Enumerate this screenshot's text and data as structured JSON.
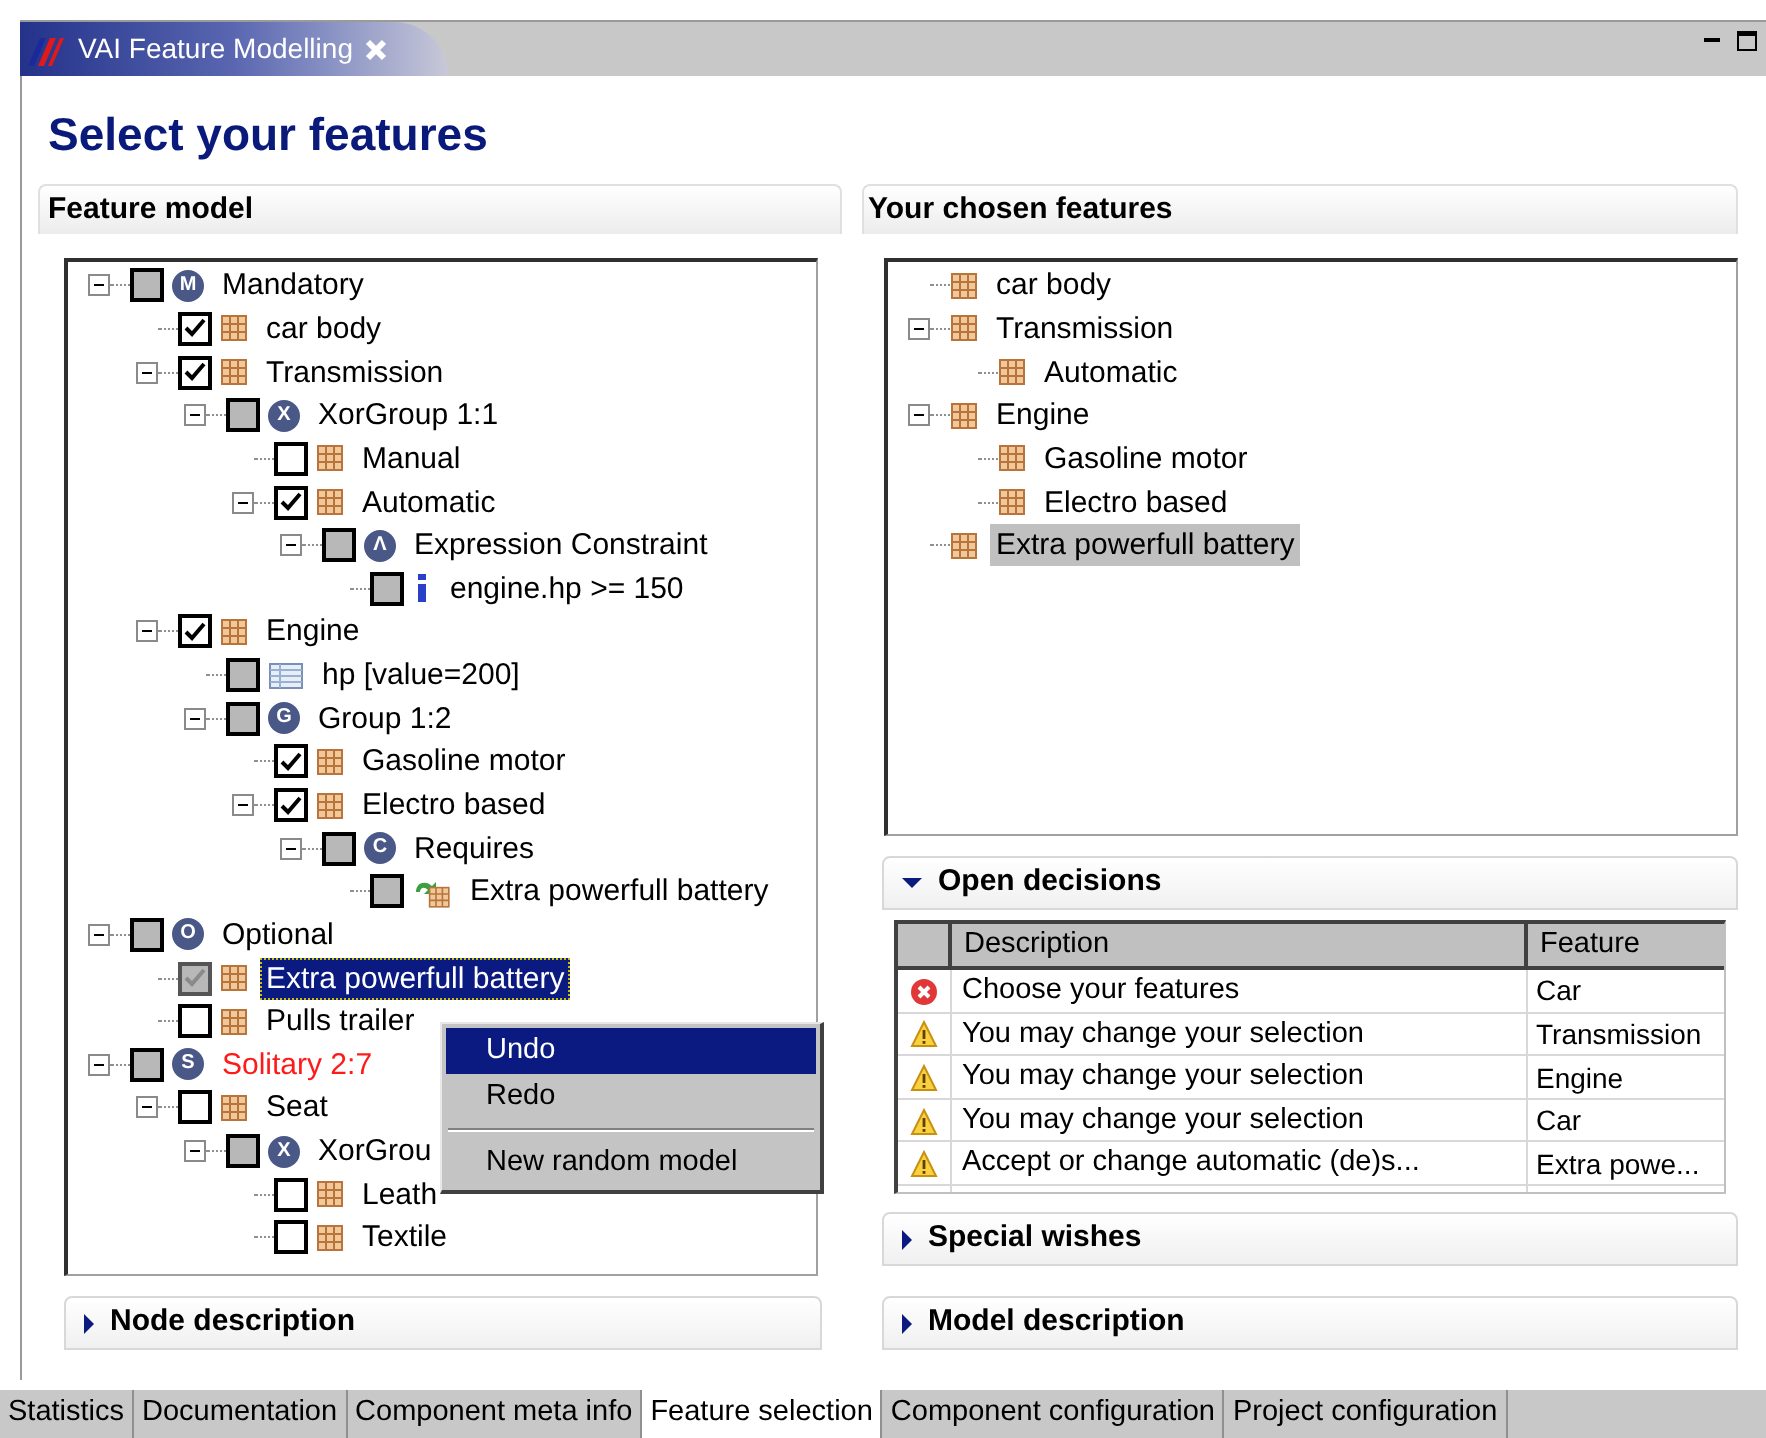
{
  "editor_tab": {
    "title": "VAI Feature Modelling"
  },
  "page_title": "Select your features",
  "feature_model": {
    "title": "Feature model",
    "tree": [
      {
        "label": "Mandatory",
        "kind": "group",
        "badge": "M",
        "checked": false,
        "disabled": true,
        "selected": false,
        "expanded": true,
        "children": [
          {
            "label": "car body",
            "kind": "feature",
            "checked": true,
            "disabled": false,
            "selected": false
          },
          {
            "label": "Transmission",
            "kind": "feature",
            "checked": true,
            "disabled": false,
            "selected": false,
            "expanded": true,
            "children": [
              {
                "label": "XorGroup 1:1",
                "kind": "group",
                "badge": "X",
                "checked": false,
                "disabled": true,
                "selected": false,
                "expanded": true,
                "children": [
                  {
                    "label": "Manual",
                    "kind": "feature",
                    "checked": false,
                    "disabled": false,
                    "selected": false
                  },
                  {
                    "label": "Automatic",
                    "kind": "feature",
                    "checked": true,
                    "disabled": false,
                    "selected": false,
                    "expanded": true,
                    "children": [
                      {
                        "label": "Expression Constraint",
                        "kind": "group",
                        "badge": "Λ",
                        "checked": false,
                        "disabled": true,
                        "selected": false,
                        "expanded": true,
                        "children": [
                          {
                            "label": "engine.hp >= 150",
                            "kind": "expression",
                            "checked": false,
                            "disabled": true,
                            "selected": false
                          }
                        ]
                      }
                    ]
                  }
                ]
              }
            ]
          },
          {
            "label": "Engine",
            "kind": "feature",
            "checked": true,
            "disabled": false,
            "selected": false,
            "expanded": true,
            "children": [
              {
                "label": "hp [value=200]",
                "kind": "attribute",
                "checked": false,
                "disabled": true,
                "selected": false
              },
              {
                "label": "Group 1:2",
                "kind": "group",
                "badge": "G",
                "checked": false,
                "disabled": true,
                "selected": false,
                "expanded": true,
                "children": [
                  {
                    "label": "Gasoline motor",
                    "kind": "feature",
                    "checked": true,
                    "disabled": false,
                    "selected": false
                  },
                  {
                    "label": "Electro based",
                    "kind": "feature",
                    "checked": true,
                    "disabled": false,
                    "selected": false,
                    "expanded": true,
                    "children": [
                      {
                        "label": "Requires",
                        "kind": "group",
                        "badge": "C",
                        "checked": false,
                        "disabled": true,
                        "selected": false,
                        "expanded": true,
                        "children": [
                          {
                            "label": "Extra powerfull battery",
                            "kind": "reference",
                            "checked": false,
                            "disabled": true,
                            "selected": false
                          }
                        ]
                      }
                    ]
                  }
                ]
              }
            ]
          }
        ]
      },
      {
        "label": "Optional",
        "kind": "group",
        "badge": "O",
        "checked": false,
        "disabled": true,
        "selected": false,
        "expanded": true,
        "children": [
          {
            "label": "Extra powerfull battery",
            "kind": "feature",
            "checked": true,
            "disabled": true,
            "selected": true
          },
          {
            "label": "Pulls trailer",
            "kind": "feature",
            "checked": false,
            "disabled": false,
            "selected": false
          }
        ]
      },
      {
        "label": "Solitary 2:7",
        "kind": "group",
        "badge": "S",
        "error": true,
        "checked": false,
        "disabled": true,
        "selected": false,
        "expanded": true,
        "children": [
          {
            "label": "Seat",
            "kind": "feature",
            "checked": false,
            "disabled": false,
            "selected": false,
            "expanded": true,
            "children": [
              {
                "label": "XorGrou",
                "kind": "group",
                "badge": "X",
                "checked": false,
                "disabled": true,
                "selected": false,
                "expanded": true,
                "children": [
                  {
                    "label": "Leath",
                    "kind": "feature",
                    "checked": false,
                    "disabled": false,
                    "selected": false
                  },
                  {
                    "label": "Textile",
                    "kind": "feature",
                    "checked": false,
                    "disabled": false,
                    "selected": false
                  }
                ]
              }
            ]
          }
        ]
      }
    ]
  },
  "node_description": {
    "title": "Node description",
    "expanded": false
  },
  "chosen_features": {
    "title": "Your chosen features",
    "tree": [
      {
        "label": "car body",
        "kind": "feature",
        "selected": false
      },
      {
        "label": "Transmission",
        "kind": "feature",
        "selected": false,
        "expanded": true,
        "children": [
          {
            "label": "Automatic",
            "kind": "feature",
            "selected": false
          }
        ]
      },
      {
        "label": "Engine",
        "kind": "feature",
        "selected": false,
        "expanded": true,
        "children": [
          {
            "label": "Gasoline motor",
            "kind": "feature",
            "selected": false
          },
          {
            "label": "Electro based",
            "kind": "feature",
            "selected": false
          }
        ]
      },
      {
        "label": "Extra powerfull battery",
        "kind": "feature",
        "selected": true
      }
    ]
  },
  "open_decisions": {
    "title": "Open decisions",
    "expanded": true,
    "columns": [
      "Description",
      "Feature"
    ],
    "rows": [
      {
        "kind": "error",
        "description": "Choose your features",
        "feature": "Car"
      },
      {
        "kind": "warning",
        "description": "You may change your selection",
        "feature": "Transmission"
      },
      {
        "kind": "warning",
        "description": "You may change your selection",
        "feature": "Engine"
      },
      {
        "kind": "warning",
        "description": "You may change your selection",
        "feature": "Car"
      },
      {
        "kind": "warning",
        "description": "Accept or change automatic (de)s...",
        "feature": "Extra powe..."
      }
    ]
  },
  "special_wishes": {
    "title": "Special wishes",
    "expanded": false
  },
  "model_description": {
    "title": "Model description",
    "expanded": false
  },
  "context_menu": {
    "items": [
      {
        "kind": "command",
        "label": "Undo",
        "selected": true
      },
      {
        "kind": "command",
        "label": "Redo",
        "selected": false
      },
      {
        "kind": "separator"
      },
      {
        "kind": "command",
        "label": "New random model",
        "selected": false
      }
    ]
  },
  "bottom_tabs": [
    {
      "label": "Statistics",
      "selected": false
    },
    {
      "label": "Documentation",
      "selected": false
    },
    {
      "label": "Component meta info",
      "selected": false
    },
    {
      "label": "Feature selection",
      "selected": true
    },
    {
      "label": "Component configuration",
      "selected": false
    },
    {
      "label": "Project configuration",
      "selected": false
    }
  ]
}
